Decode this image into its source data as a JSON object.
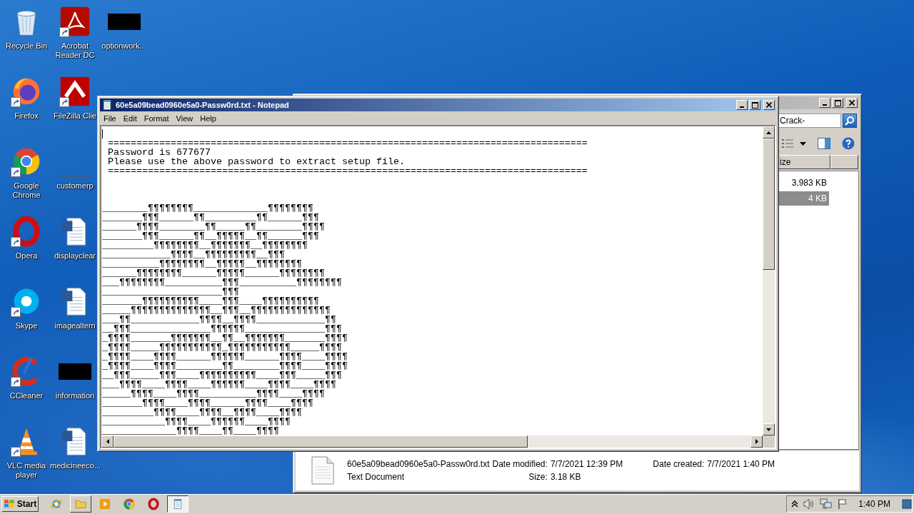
{
  "desktop_icons": [
    {
      "label": "Recycle Bin",
      "kind": "recycle",
      "shortcut": false
    },
    {
      "label": "Firefox",
      "kind": "firefox",
      "shortcut": true
    },
    {
      "label": "Google Chrome",
      "kind": "chrome",
      "shortcut": true
    },
    {
      "label": "Opera",
      "kind": "opera",
      "shortcut": true
    },
    {
      "label": "Skype",
      "kind": "skype",
      "shortcut": true
    },
    {
      "label": "CCleaner",
      "kind": "ccleaner",
      "shortcut": true
    },
    {
      "label": "VLC media player",
      "kind": "vlc",
      "shortcut": true
    },
    {
      "label": "Acrobat Reader DC",
      "kind": "acrobat",
      "shortcut": true
    },
    {
      "label": "FileZilla Clie",
      "kind": "filezilla",
      "shortcut": true
    },
    {
      "label": "customerp",
      "kind": "blank",
      "shortcut": false
    },
    {
      "label": "displayclear",
      "kind": "word",
      "shortcut": false
    },
    {
      "label": "imagealtern",
      "kind": "word",
      "shortcut": false
    },
    {
      "label": "information",
      "kind": "redacted",
      "shortcut": false
    },
    {
      "label": "medicineeco...",
      "kind": "word",
      "shortcut": false
    },
    {
      "label": "optionwork...",
      "kind": "redacted",
      "shortcut": false
    }
  ],
  "explorer": {
    "search_value": "Crack-",
    "columns": [
      "ize"
    ],
    "rows": [
      {
        "size": "3,983 KB",
        "selected": false
      },
      {
        "size": "4 KB",
        "selected": true
      }
    ],
    "details": {
      "name": "60e5a09bead0960e5a0-Passw0rd.txt",
      "type": "Text Document",
      "fields": [
        {
          "label": "Date modified:",
          "value": "7/7/2021 12:39 PM"
        },
        {
          "label": "Size:",
          "value": "3.18 KB"
        },
        {
          "label": "Date created:",
          "value": "7/7/2021 1:40 PM"
        }
      ]
    }
  },
  "notepad": {
    "title": "60e5a09bead0960e5a0-Passw0rd.txt - Notepad",
    "menu": [
      "File",
      "Edit",
      "Format",
      "View",
      "Help"
    ],
    "text": "\n ====================================================================================\n Password is 677677\n Please use the above password to extract setup file.\n ====================================================================================\n\n\n\n________¶¶¶¶¶¶¶¶_____________¶¶¶¶¶¶¶¶\n_______¶¶¶______¶¶_________¶¶______¶¶¶\n______¶¶¶¶________¶¶_____¶¶________¶¶¶¶\n_______¶¶¶______¶¶__¶¶¶¶¶__¶¶______¶¶¶\n_________¶¶¶¶¶¶¶¶__¶¶¶¶¶¶¶__¶¶¶¶¶¶¶¶\n____________¶¶¶¶__¶¶¶¶¶¶¶¶¶__¶¶¶\n__________¶¶¶¶¶¶¶¶__¶¶¶¶¶__¶¶¶¶¶¶¶¶\n______¶¶¶¶¶¶¶¶______¶¶¶¶¶______¶¶¶¶¶¶¶¶\n___¶¶¶¶¶¶¶¶__________¶¶¶__________¶¶¶¶¶¶¶¶\n_____________________¶¶¶\n_______¶¶¶¶¶¶¶¶¶¶____¶¶¶____¶¶¶¶¶¶¶¶¶¶\n_____¶¶¶¶¶¶¶¶¶¶¶¶¶¶__¶¶¶__¶¶¶¶¶¶¶¶¶¶¶¶¶¶\n___¶¶____________¶¶¶¶__¶¶¶¶____________¶¶\n__¶¶¶______________¶¶¶¶¶¶______________¶¶¶\n_¶¶¶¶_______¶¶¶¶¶¶¶__¶¶__¶¶¶¶¶¶¶_______¶¶¶¶\n_¶¶¶¶_____¶¶¶¶¶¶¶¶¶¶¶_¶¶¶¶¶¶¶¶¶¶¶_____¶¶¶¶\n_¶¶¶¶____¶¶¶¶______¶¶¶¶¶¶______¶¶¶¶____¶¶¶¶\n_¶¶¶¶____¶¶¶¶________¶¶________¶¶¶¶____¶¶¶¶\n__¶¶¶_____¶¶¶____¶¶¶¶¶¶¶¶¶¶____¶¶¶_____¶¶¶\n___¶¶¶¶____¶¶¶¶____¶¶¶¶¶¶____¶¶¶¶____¶¶¶¶\n_____¶¶¶¶____¶¶¶¶__________¶¶¶¶____¶¶¶¶\n_______¶¶¶¶____¶¶¶¶______¶¶¶¶____¶¶¶¶\n_________¶¶¶¶____¶¶¶¶__¶¶¶¶____¶¶¶¶\n___________¶¶¶¶____¶¶¶¶¶¶____¶¶¶¶\n_____________¶¶¶¶____¶¶____¶¶¶¶"
  },
  "taskbar": {
    "start_label": "Start",
    "buttons": [
      {
        "kind": "ie",
        "open": false,
        "active": false
      },
      {
        "kind": "folder",
        "open": true,
        "active": false
      },
      {
        "kind": "media",
        "open": false,
        "active": false
      },
      {
        "kind": "chrome",
        "open": false,
        "active": false
      },
      {
        "kind": "opera",
        "open": false,
        "active": false
      },
      {
        "kind": "notepad",
        "open": true,
        "active": true
      }
    ],
    "clock": "1:40 PM"
  }
}
